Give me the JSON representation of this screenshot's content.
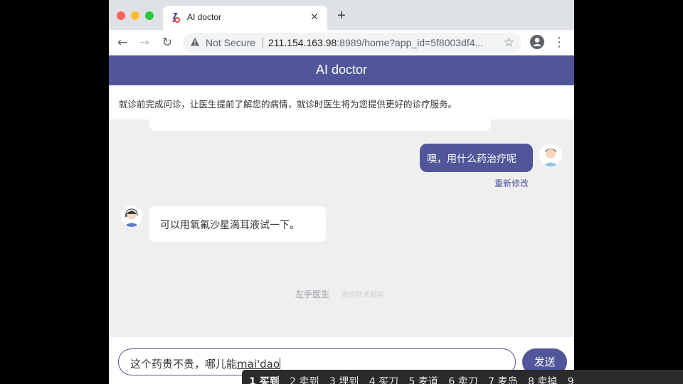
{
  "browser": {
    "tab_title": "AI doctor",
    "tab_close": "×",
    "new_tab": "+",
    "security_label": "Not Secure",
    "url_host": "211.154.163.98",
    "url_rest": ":8989/home?app_id=5f8003df4...",
    "icons": [
      "arrow-left-icon",
      "arrow-right-icon",
      "reload-icon",
      "warning-icon",
      "star-icon",
      "profile-icon",
      "kebab-menu-icon"
    ]
  },
  "app": {
    "title": "AI doctor",
    "notice": "就诊前完成问诊，让医生提前了解您的病情，就诊时医生将为您提供更好的诊疗服务。"
  },
  "chat": {
    "user_message": "噢，用什么药治疗呢",
    "edit_link": "重新修改",
    "bot_message": "可以用氧氟沙星滴耳液试一下。",
    "brand": "左手医生",
    "brand_sub": "提供技术服务"
  },
  "composer": {
    "committed_text": "这个药贵不贵，哪儿能",
    "composing_text": "mai'dao",
    "send_label": "发送"
  },
  "ime": {
    "candidates": [
      "1 买到",
      "2 卖到",
      "3 埋到",
      "4 买刀",
      "5 麦道",
      "6 卖刀",
      "7 麦岛",
      "8 卖掉",
      "9"
    ]
  },
  "colors": {
    "accent": "#505699",
    "chat_bg": "#efeff0"
  }
}
